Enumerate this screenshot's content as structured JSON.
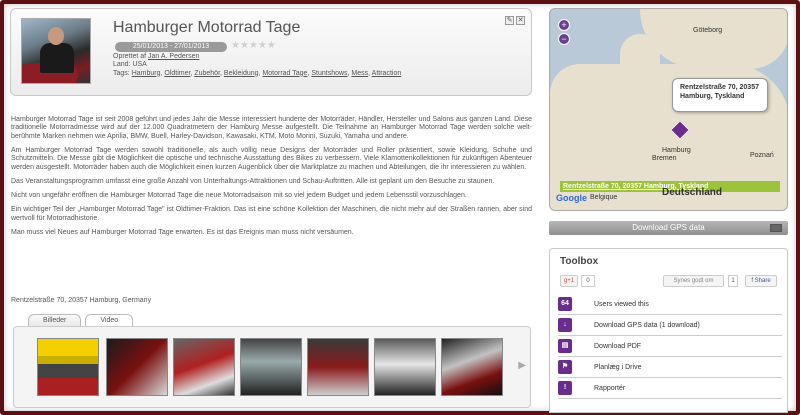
{
  "event": {
    "title": "Hamburger Motorrad Tage",
    "dates": "25/01/2013 - 27/01/2013",
    "stars": "★★★★★",
    "created_label": "Oprettet af",
    "creator": "Jan A. Pedersen",
    "country_line": "Land: USA",
    "tags_label": "Tags:",
    "tags": [
      "Hamburg",
      "Oldtimer",
      "Zubehör",
      "Bekleidung",
      "Motorrad Tage",
      "Stuntshows",
      "Mess",
      "Attraction"
    ]
  },
  "edit_icons": [
    "pencil-icon",
    "close-icon"
  ],
  "description": [
    "Hamburger Motorrad Tage ist seit 2008 geführt und jedes Jahr die Messe interessiert hunderte der Motorräder, Händler, Hersteller und Salons aus ganzen Land. Diese traditionelle Motorradmesse wird auf der 12.000 Quadratmetern der Hamburg Messe aufgestellt. Die Teilnahme an Hamburger Motorrad Tage werden solche welt-berühmte Marken nehmen wie Aprilia, BMW, Buell, Harley-Davidson, Kawasaki, KTM, Moto Morini, Suzuki, Yamaha und andere.",
    "Am Hamburger Motorrad Tage werden sowohl traditionelle, als auch völlig neue Designs der Motorräder und Roller präsentiert, sowie Kleidung, Schuhe und Schutzmitteln.  Die Messe gibt die Möglichkeit die optische und technische Ausstattung des Bikes zu verbessern. Viele Klamottenkollektionen für zukünftigen Abenteuer werden ausgestellt. Motorräder haben auch die Möglichkeit einen kurzen Augenblick über die Marktplatze zu machen und Abteilungen, die ihr interessieren zu wählen.",
    "Das Veranstaltungsprogramm umfasst eine große Anzahl von Unterhaltungs-Attraktionen und Schau-Auftritten. Alle ist geplant um den Besuche zu staunen.",
    "Nicht von ungefähr eröffnen die Hamburger Motorrad Tage die neue Motorradsaison mit so viel jedem Budget und jedem Lebensstil vorzuschlagen.",
    "Ein wichtiger Teil der „Hamburger Motorrad Tage\" ist Oldtimer-Fraktion. Das ist eine schöne Kollektion der Maschinen, die nicht mehr auf der Straßen rannen, aber sind wertvoll für Motorradhistorie.",
    "Man muss viel Neues auf Hamburger Motorrad Tage erwarten. Es ist das Ereignis man muss nicht versäumen."
  ],
  "address": "Rentzelstraße 70, 20357 Hamburg, Germany",
  "tabs": [
    "Billeder",
    "Video"
  ],
  "gallery_next": "▶",
  "map": {
    "zoom_in": "+",
    "zoom_out": "−",
    "popup_line1": "Rentzelstraße 70, 20357",
    "popup_line2": "Hamburg, Tyskland",
    "address_bar": "Rentzelstraße 70, 20357 Hamburg, Tyskland",
    "country_label": "Deutschland",
    "google": "Google",
    "cities": [
      "Göteborg",
      "Hamburg",
      "Bremen",
      "Poznań",
      "Belgique"
    ]
  },
  "gps_button": "Download GPS data",
  "toolbox": {
    "title": "Toolbox",
    "gplus": "g+1",
    "gplus_count": "0",
    "like_label": "Synes godt om",
    "like_count": "1",
    "share_label": "f Share",
    "items": [
      {
        "icon": "64",
        "label": "Users viewed this"
      },
      {
        "icon": "↓",
        "label": "Download GPS data (1 download)"
      },
      {
        "icon": "▤",
        "label": "Download PDF"
      },
      {
        "icon": "⚑",
        "label": "Planlæg i Drive"
      },
      {
        "icon": "!",
        "label": "Rapportér"
      }
    ]
  }
}
